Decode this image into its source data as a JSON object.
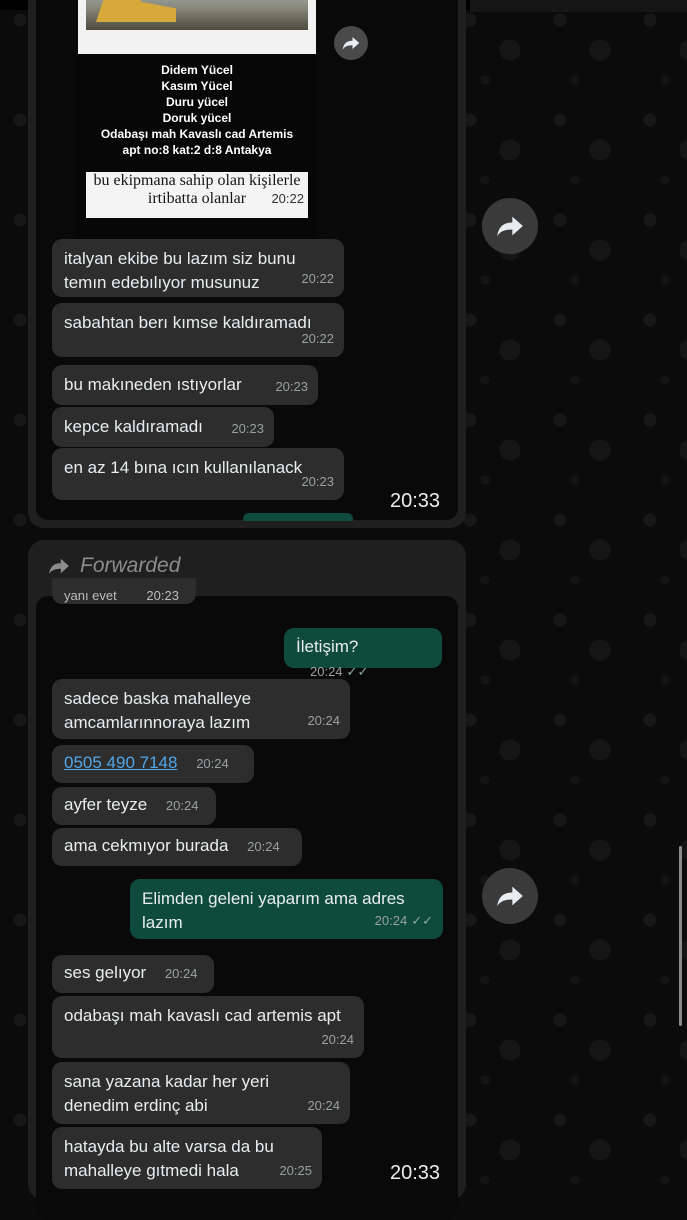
{
  "top_card": {
    "doc_names": [
      "Didem Yücel",
      "Kasım Yücel",
      "Duru yücel",
      "Doruk yücel",
      "Odabaşı mah Kavaslı cad Artemis",
      "apt no:8 kat:2 d:8 Antakya"
    ],
    "doc_paper_text": "bu ekipmana sahip olan kişilerle irtibatta olanlar",
    "image_time": "20:22",
    "messages": [
      {
        "text": "italyan ekibe bu lazım siz bunu temın edebılıyor musunuz",
        "time": "20:22"
      },
      {
        "text": "sabahtan berı kımse kaldıramadı",
        "time": "20:22"
      },
      {
        "text": "bu makıneden ıstıyorlar",
        "time": "20:23"
      },
      {
        "text": "kepce kaldıramadı",
        "time": "20:23"
      },
      {
        "text": "en az 14 bına ıcın kullanılanack",
        "time": "20:23"
      }
    ],
    "screenshot_time": "20:33"
  },
  "bottom_card": {
    "forwarded_label": "Forwarded",
    "cut_text": "yanı evet",
    "cut_time": "20:23",
    "messages": [
      {
        "text": "İletişim?",
        "time": "20:24",
        "ticks": "✓✓"
      },
      {
        "text": "sadece baska mahalleye amcamlarınnoraya lazım",
        "time": "20:24"
      },
      {
        "text": "0505 490 7148",
        "time": "20:24"
      },
      {
        "text": "ayfer teyze",
        "time": "20:24"
      },
      {
        "text": "ama cekmıyor burada",
        "time": "20:24"
      },
      {
        "text": "Elimden geleni yaparım ama adres lazım",
        "time": "20:24",
        "ticks": "✓✓"
      },
      {
        "text": "ses gelıyor",
        "time": "20:24"
      },
      {
        "text": "odabaşı mah kavaslı cad artemis apt",
        "time": "20:24"
      },
      {
        "text": "sana yazana kadar her yeri denedim erdinç abi",
        "time": "20:24"
      },
      {
        "text": "hatayda bu alte varsa da bu mahalleye gıtmedi hala",
        "time": "20:25"
      }
    ],
    "screenshot_time": "20:33"
  },
  "icons": [
    "share-arrow-icon",
    "forward-arrow-icon"
  ],
  "colors": {
    "incoming_bubble": "#2d2d2d",
    "outgoing_bubble": "#0f4a3e",
    "link": "#53a6e8",
    "background": "#0b0b0b"
  }
}
